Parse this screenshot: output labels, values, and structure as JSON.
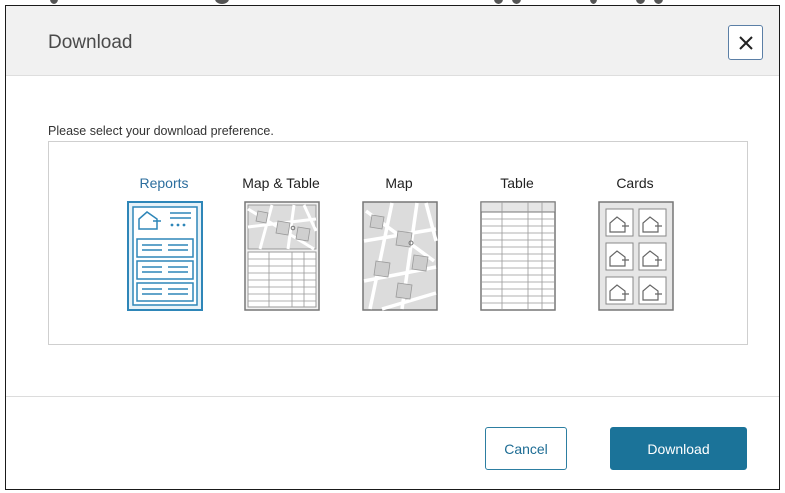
{
  "dialog": {
    "title": "Download",
    "close_icon": "close-icon",
    "prompt": "Please select your download preference.",
    "selected": "Reports",
    "options": [
      {
        "label": "Reports",
        "icon": "report-doc-icon"
      },
      {
        "label": "Map & Table",
        "icon": "map-table-icon"
      },
      {
        "label": "Map",
        "icon": "map-icon"
      },
      {
        "label": "Table",
        "icon": "table-icon"
      },
      {
        "label": "Cards",
        "icon": "cards-icon"
      }
    ],
    "cancel_label": "Cancel",
    "download_label": "Download"
  },
  "colors": {
    "accent": "#1b7399",
    "selected_text": "#2c6e9e",
    "header_bg": "#f1f1f1"
  }
}
